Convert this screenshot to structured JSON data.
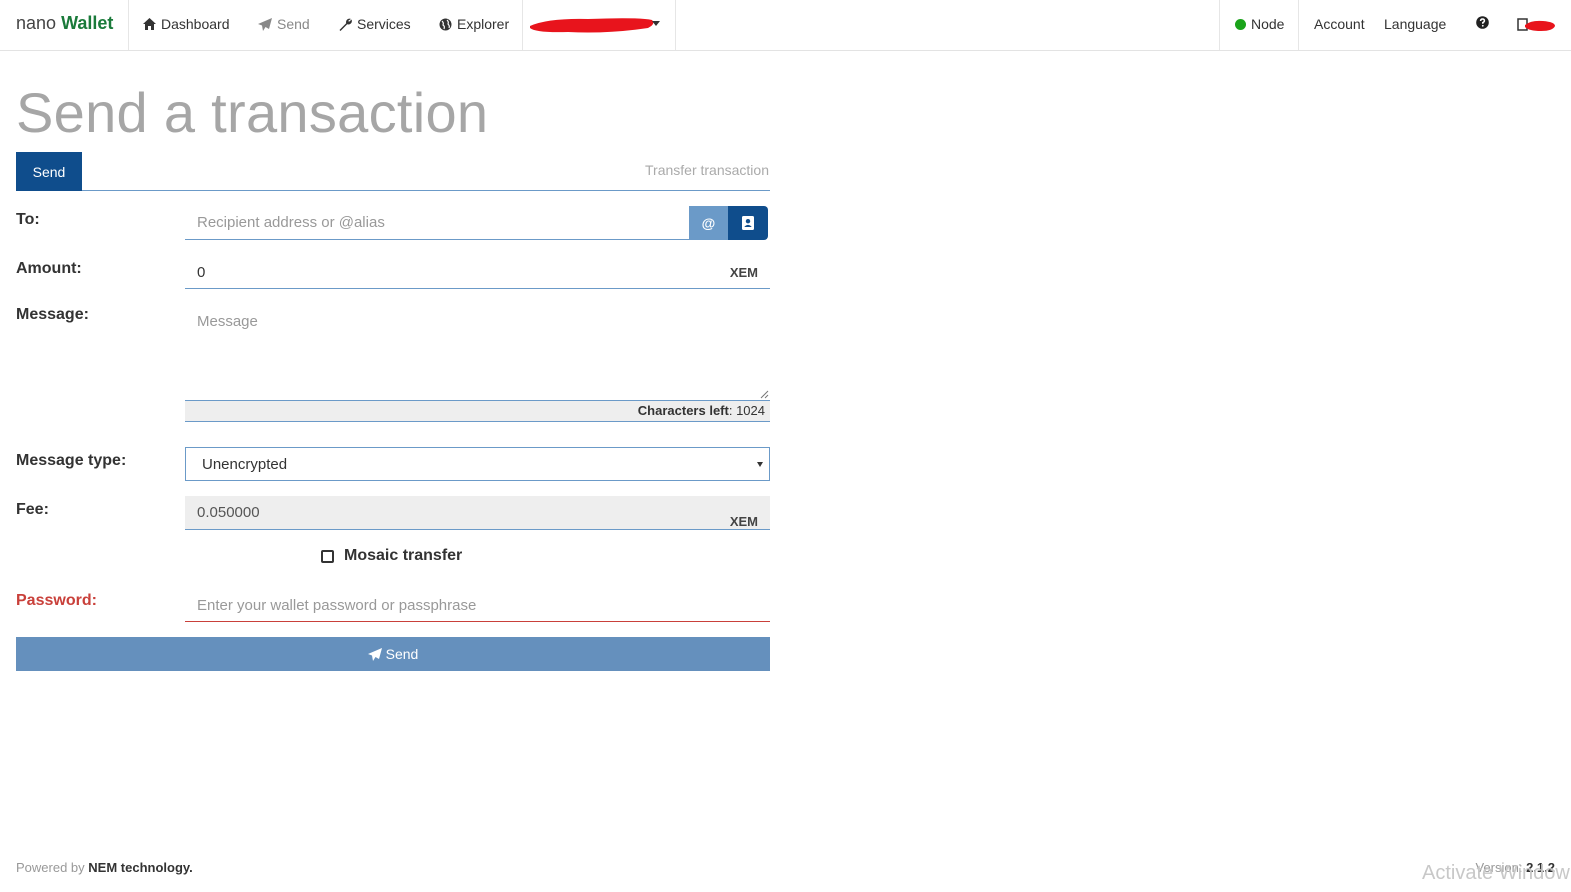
{
  "nav": {
    "brand_light": "nano",
    "brand_strong": "Wallet",
    "dashboard": "Dashboard",
    "send": "Send",
    "services": "Services",
    "explorer": "Explorer",
    "node": "Node",
    "account": "Account",
    "language": "Language"
  },
  "page": {
    "title": "Send a transaction"
  },
  "tabs": {
    "send": "Send",
    "type": "Transfer transaction"
  },
  "form": {
    "to_label": "To:",
    "to_placeholder": "Recipient address or @alias",
    "alias_button": "@",
    "amount_label": "Amount:",
    "amount_value": "0",
    "amount_unit": "XEM",
    "message_label": "Message:",
    "message_placeholder": "Message",
    "chars_left_label": "Characters left",
    "chars_left_value": "1024",
    "message_type_label": "Message type:",
    "message_type_value": "Unencrypted",
    "fee_label": "Fee:",
    "fee_value": "0.050000",
    "fee_unit": "XEM",
    "mosaic_label": "Mosaic transfer",
    "password_label": "Password:",
    "password_placeholder": "Enter your wallet password or passphrase",
    "send_button": "Send"
  },
  "footer": {
    "powered_by": "Powered by",
    "powered_strong": "NEM technology.",
    "version_label": "Version:",
    "version_value": "2.1.2",
    "watermark": "Activate Window"
  },
  "colors": {
    "brand_green": "#1a7a3a",
    "primary_blue": "#0f4d8c",
    "light_blue": "#6590bd",
    "error_red": "#c9403a",
    "node_online": "#1aa31a"
  }
}
